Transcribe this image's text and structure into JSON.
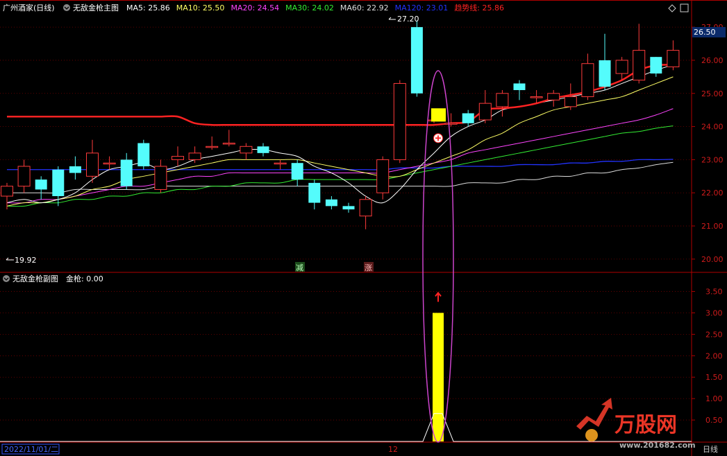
{
  "main_panel": {
    "stock_name": "广州酒家(日线)",
    "indicator_name": "无敌金枪主图",
    "ma": [
      {
        "label": "MA5: 25.86",
        "color": "#ffffff"
      },
      {
        "label": "MA10: 25.50",
        "color": "#ffff66"
      },
      {
        "label": "MA20: 24.54",
        "color": "#ff44ff"
      },
      {
        "label": "MA30: 24.02",
        "color": "#33ee33"
      },
      {
        "label": "MA60: 22.92",
        "color": "#dddddd"
      },
      {
        "label": "MA120: 23.01",
        "color": "#2233ff"
      },
      {
        "label": "趋势线: 25.86",
        "color": "#ff2222"
      }
    ],
    "high_label": "27.20",
    "low_label": "19.92",
    "current_price": "26.50",
    "signal_sell": "减",
    "signal_rise": "涨"
  },
  "sub_panel": {
    "indicator_name": "无敌金枪副图",
    "value_label": "金枪: 0.00"
  },
  "x_axis": {
    "date_label": "2022/11/01/二",
    "month_label": "12",
    "period_label": "日线"
  },
  "watermark": {
    "brand": "万股网",
    "url": "www.201682.com"
  },
  "colors": {
    "up": "#ff3b3b",
    "down": "#54fcfc",
    "axis": "#b00000",
    "grid": "#7a0000",
    "text_axis": "#d01c1c",
    "highlight": "#ffff00",
    "ellipse": "#cc44cc"
  },
  "chart_data": [
    {
      "type": "candlestick",
      "title": "无敌金枪主图",
      "ylim": [
        19.6,
        27.4
      ],
      "y_ticks": [
        20.0,
        21.0,
        22.0,
        23.0,
        24.0,
        25.0,
        26.0,
        27.0
      ],
      "candles": [
        {
          "o": 21.9,
          "c": 22.2,
          "h": 22.3,
          "l": 21.5
        },
        {
          "o": 22.2,
          "c": 22.8,
          "h": 23.0,
          "l": 22.0
        },
        {
          "o": 22.4,
          "c": 22.1,
          "h": 22.5,
          "l": 21.8
        },
        {
          "o": 22.7,
          "c": 21.9,
          "h": 22.8,
          "l": 21.6
        },
        {
          "o": 22.8,
          "c": 22.6,
          "h": 23.1,
          "l": 22.4
        },
        {
          "o": 22.5,
          "c": 23.2,
          "h": 23.6,
          "l": 22.3
        },
        {
          "o": 22.9,
          "c": 22.9,
          "h": 23.1,
          "l": 22.7
        },
        {
          "o": 23.0,
          "c": 22.2,
          "h": 23.2,
          "l": 22.1
        },
        {
          "o": 23.5,
          "c": 22.8,
          "h": 23.6,
          "l": 22.7
        },
        {
          "o": 22.1,
          "c": 22.8,
          "h": 23.0,
          "l": 22.0
        },
        {
          "o": 23.0,
          "c": 23.1,
          "h": 23.4,
          "l": 22.8
        },
        {
          "o": 23.0,
          "c": 23.2,
          "h": 23.4,
          "l": 22.9
        },
        {
          "o": 23.4,
          "c": 23.4,
          "h": 23.7,
          "l": 23.3
        },
        {
          "o": 23.5,
          "c": 23.5,
          "h": 23.9,
          "l": 23.4
        },
        {
          "o": 23.2,
          "c": 23.4,
          "h": 23.5,
          "l": 23.0
        },
        {
          "o": 23.4,
          "c": 23.2,
          "h": 23.5,
          "l": 23.1
        },
        {
          "o": 22.9,
          "c": 22.9,
          "h": 23.0,
          "l": 22.7
        },
        {
          "o": 22.9,
          "c": 22.4,
          "h": 23.0,
          "l": 22.2
        },
        {
          "o": 22.3,
          "c": 21.7,
          "h": 22.4,
          "l": 21.5
        },
        {
          "o": 21.8,
          "c": 21.6,
          "h": 21.9,
          "l": 21.5
        },
        {
          "o": 21.6,
          "c": 21.5,
          "h": 21.7,
          "l": 21.4
        },
        {
          "o": 21.3,
          "c": 21.8,
          "h": 21.9,
          "l": 20.9
        },
        {
          "o": 22.0,
          "c": 23.0,
          "h": 23.1,
          "l": 21.8
        },
        {
          "o": 23.0,
          "c": 25.3,
          "h": 25.4,
          "l": 22.9
        },
        {
          "o": 27.0,
          "c": 25.0,
          "h": 27.2,
          "l": 24.9
        },
        {
          "o": 24.2,
          "c": 24.2,
          "h": 24.3,
          "l": 24.1
        },
        {
          "o": 24.1,
          "c": 24.1,
          "h": 24.4,
          "l": 24.0
        },
        {
          "o": 24.4,
          "c": 24.1,
          "h": 24.5,
          "l": 24.0
        },
        {
          "o": 24.2,
          "c": 24.7,
          "h": 25.1,
          "l": 24.1
        },
        {
          "o": 24.6,
          "c": 25.0,
          "h": 25.1,
          "l": 24.3
        },
        {
          "o": 25.3,
          "c": 25.1,
          "h": 25.4,
          "l": 24.8
        },
        {
          "o": 24.9,
          "c": 24.9,
          "h": 25.1,
          "l": 24.7
        },
        {
          "o": 24.8,
          "c": 25.0,
          "h": 25.1,
          "l": 24.6
        },
        {
          "o": 24.6,
          "c": 24.9,
          "h": 25.3,
          "l": 24.5
        },
        {
          "o": 24.9,
          "c": 25.9,
          "h": 26.2,
          "l": 24.8
        },
        {
          "o": 26.0,
          "c": 25.2,
          "h": 26.8,
          "l": 25.1
        },
        {
          "o": 25.6,
          "c": 26.0,
          "h": 26.1,
          "l": 25.4
        },
        {
          "o": 25.4,
          "c": 26.3,
          "h": 27.1,
          "l": 25.3
        },
        {
          "o": 26.1,
          "c": 25.6,
          "h": 26.1,
          "l": 25.5
        },
        {
          "o": 25.8,
          "c": 26.3,
          "h": 26.6,
          "l": 25.7
        }
      ],
      "series": [
        {
          "key": "趋势线",
          "color": "#ff2222",
          "width": 2.5,
          "values": [
            24.3,
            24.3,
            24.3,
            24.3,
            24.3,
            24.3,
            24.3,
            24.3,
            24.3,
            24.3,
            24.3,
            24.1,
            24.05,
            24.05,
            24.05,
            24.05,
            24.05,
            24.05,
            24.05,
            24.05,
            24.05,
            24.05,
            24.05,
            24.05,
            24.05,
            24.05,
            24.1,
            24.15,
            24.5,
            24.55,
            24.6,
            24.7,
            24.85,
            24.95,
            25.05,
            25.2,
            25.4,
            25.7,
            25.85,
            25.86
          ]
        },
        {
          "key": "MA5",
          "color": "#ffffff",
          "width": 1,
          "values": [
            21.7,
            21.8,
            21.7,
            21.8,
            22.0,
            22.4,
            22.7,
            22.8,
            22.9,
            22.7,
            22.8,
            23.0,
            23.1,
            23.2,
            23.3,
            23.3,
            23.2,
            23.1,
            22.8,
            22.6,
            22.3,
            21.9,
            21.7,
            22.1,
            22.7,
            23.2,
            23.7,
            24.0,
            24.2,
            24.5,
            24.6,
            24.7,
            24.8,
            24.9,
            25.0,
            25.1,
            25.3,
            25.5,
            25.7,
            25.86
          ]
        },
        {
          "key": "MA10",
          "color": "#ffff66",
          "width": 1,
          "values": [
            21.6,
            21.7,
            21.7,
            21.8,
            21.9,
            22.1,
            22.2,
            22.4,
            22.5,
            22.6,
            22.7,
            22.8,
            22.9,
            23.0,
            23.0,
            23.0,
            23.0,
            23.0,
            22.9,
            22.8,
            22.7,
            22.6,
            22.5,
            22.5,
            22.7,
            22.9,
            23.1,
            23.3,
            23.6,
            23.8,
            24.1,
            24.3,
            24.5,
            24.6,
            24.7,
            24.8,
            24.9,
            25.1,
            25.3,
            25.5
          ]
        },
        {
          "key": "MA20",
          "color": "#ff44ff",
          "width": 1,
          "values": [
            21.7,
            21.7,
            21.8,
            21.8,
            21.9,
            22.0,
            22.1,
            22.2,
            22.2,
            22.3,
            22.4,
            22.5,
            22.5,
            22.6,
            22.6,
            22.6,
            22.6,
            22.6,
            22.6,
            22.6,
            22.6,
            22.6,
            22.6,
            22.7,
            22.8,
            22.9,
            23.0,
            23.2,
            23.3,
            23.4,
            23.5,
            23.6,
            23.7,
            23.8,
            23.9,
            24.0,
            24.1,
            24.2,
            24.35,
            24.54
          ]
        },
        {
          "key": "MA30",
          "color": "#33ee33",
          "width": 1,
          "values": [
            21.6,
            21.6,
            21.7,
            21.7,
            21.8,
            21.8,
            21.9,
            21.9,
            22.0,
            22.0,
            22.1,
            22.1,
            22.2,
            22.2,
            22.3,
            22.3,
            22.3,
            22.4,
            22.4,
            22.4,
            22.4,
            22.4,
            22.4,
            22.5,
            22.6,
            22.7,
            22.8,
            22.9,
            23.0,
            23.1,
            23.2,
            23.3,
            23.4,
            23.5,
            23.6,
            23.7,
            23.8,
            23.85,
            23.95,
            24.02
          ]
        },
        {
          "key": "MA60",
          "color": "#dddddd",
          "width": 1,
          "values": [
            22.0,
            22.0,
            22.0,
            22.0,
            22.1,
            22.1,
            22.1,
            22.1,
            22.1,
            22.2,
            22.2,
            22.2,
            22.2,
            22.2,
            22.2,
            22.2,
            22.2,
            22.2,
            22.2,
            22.2,
            22.2,
            22.2,
            22.2,
            22.2,
            22.2,
            22.2,
            22.2,
            22.3,
            22.3,
            22.3,
            22.4,
            22.4,
            22.5,
            22.5,
            22.6,
            22.6,
            22.7,
            22.75,
            22.85,
            22.92
          ]
        },
        {
          "key": "MA120",
          "color": "#2233ff",
          "width": 1.3,
          "values": [
            22.7,
            22.7,
            22.7,
            22.7,
            22.7,
            22.7,
            22.7,
            22.7,
            22.7,
            22.7,
            22.7,
            22.7,
            22.7,
            22.7,
            22.7,
            22.7,
            22.7,
            22.7,
            22.7,
            22.7,
            22.7,
            22.7,
            22.7,
            22.75,
            22.75,
            22.75,
            22.8,
            22.8,
            22.8,
            22.8,
            22.85,
            22.85,
            22.85,
            22.9,
            22.9,
            22.95,
            22.95,
            23.0,
            23.0,
            23.01
          ]
        }
      ],
      "signals": {
        "sell_index": 17,
        "rise_index": 21,
        "golden_gun_index": 25
      }
    },
    {
      "type": "bar",
      "title": "无敌金枪副图",
      "ylim": [
        0,
        3.8
      ],
      "y_ticks": [
        0.5,
        1.0,
        1.5,
        2.0,
        2.5,
        3.0,
        3.5
      ],
      "bars": [
        {
          "index": 25,
          "value": 3.0
        }
      ],
      "spike": {
        "index": 25,
        "value": 0.65
      }
    }
  ]
}
